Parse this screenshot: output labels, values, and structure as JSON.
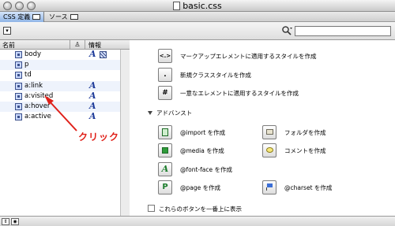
{
  "window": {
    "title": "basic.css"
  },
  "tabs": [
    {
      "label": "CSS 定義"
    },
    {
      "label": "ソース"
    }
  ],
  "list": {
    "columns": {
      "name": "名前",
      "info": "情報"
    },
    "items": [
      {
        "name": "body"
      },
      {
        "name": "p"
      },
      {
        "name": "td"
      },
      {
        "name": "a:link"
      },
      {
        "name": "a:visited"
      },
      {
        "name": "a:hover"
      },
      {
        "name": "a:active"
      }
    ]
  },
  "annotation": {
    "text": "クリック",
    "color": "#e0211a"
  },
  "actions": {
    "primary": [
      {
        "glyph": "<.>",
        "label": "マークアップエレメントに適用するスタイルを作成"
      },
      {
        "glyph": ".",
        "label": "新規クラススタイルを作成"
      },
      {
        "glyph": "#",
        "label": "一意なエレメントに適用するスタイルを作成"
      }
    ],
    "advanced_title": "アドバンスト",
    "advanced": [
      {
        "label": "@import を作成"
      },
      {
        "label": "フォルダを作成"
      },
      {
        "label": "@media を作成"
      },
      {
        "label": "コメントを作成"
      },
      {
        "label": "@font-face を作成"
      },
      {
        "glyph": "P",
        "label": "@page を作成"
      },
      {
        "label": "@charset を作成"
      }
    ],
    "checkbox_label": "これらのボタンを一番上に表示"
  }
}
